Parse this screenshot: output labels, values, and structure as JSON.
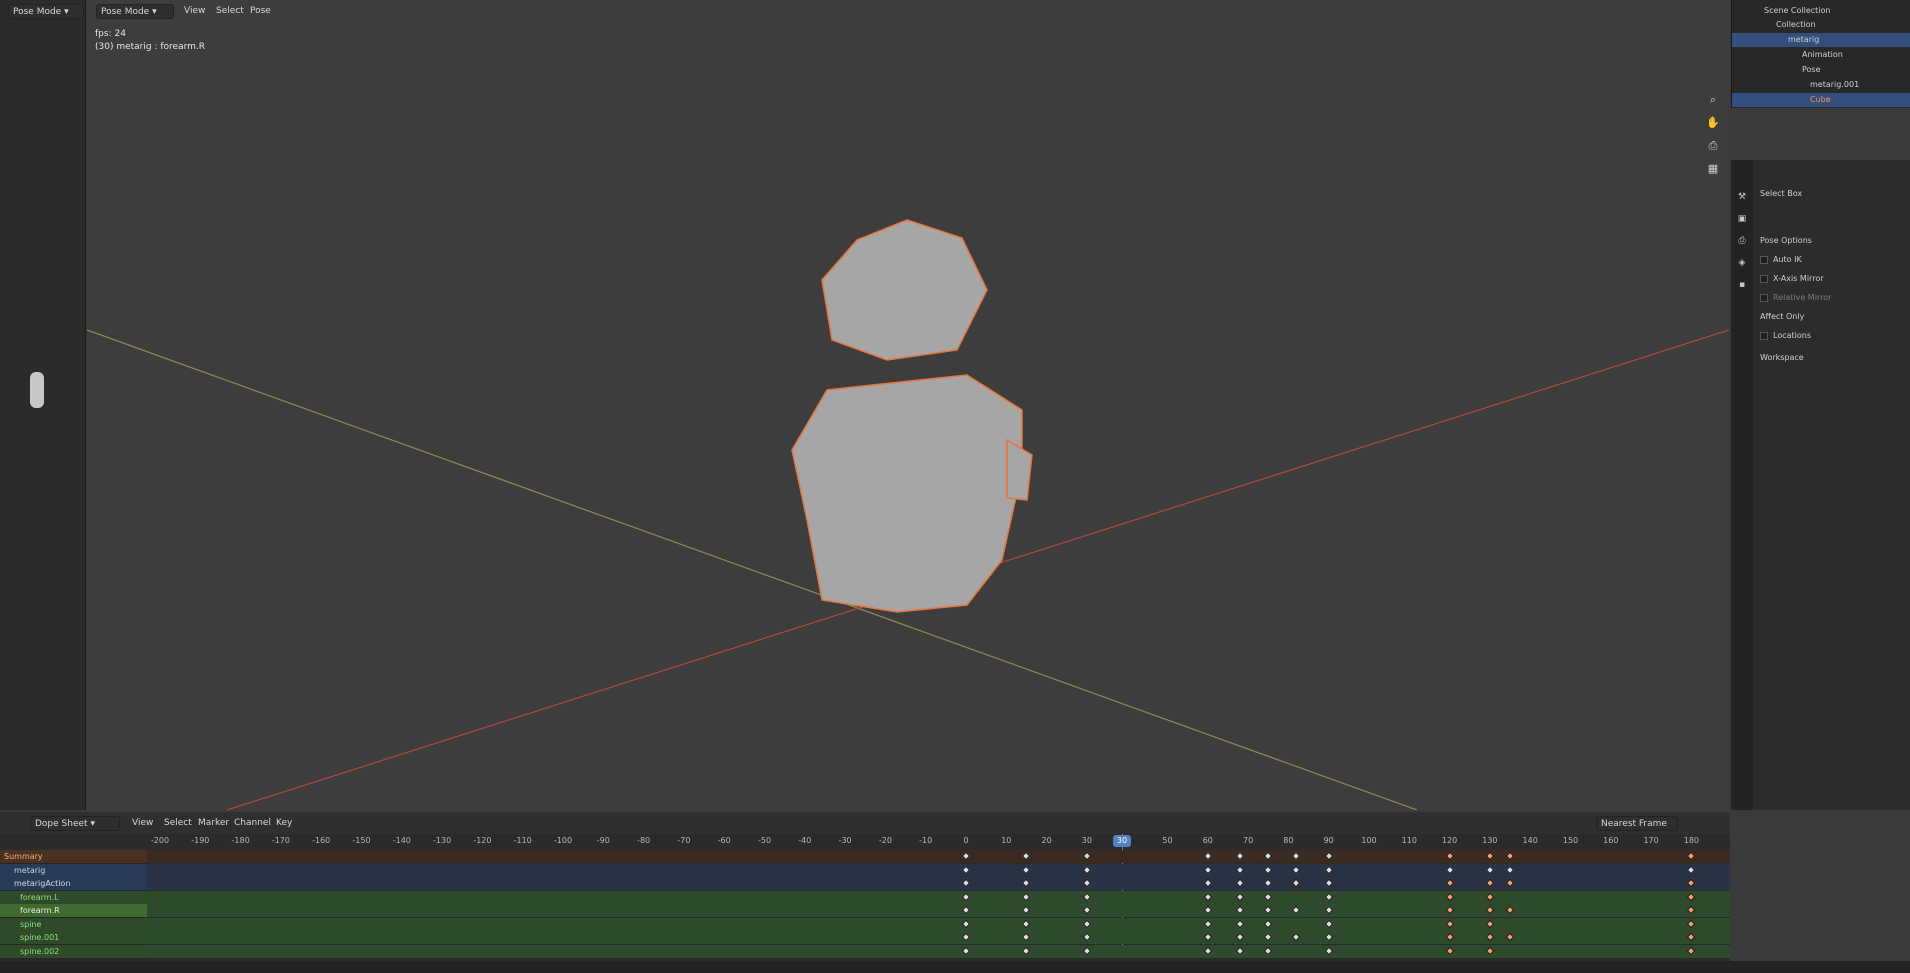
{
  "viewport": {
    "mode": "Pose Mode",
    "mode2": "Pose Mode",
    "menus": [
      "View",
      "Select",
      "Pose"
    ],
    "fps": "fps: 24",
    "active": "(30) metarig : forearm.R"
  },
  "outliner": {
    "root": "Scene Collection",
    "rows": [
      "Collection",
      "metarig",
      "Animation",
      "Pose",
      "metarig.001",
      "Cube"
    ]
  },
  "properties": {
    "tool": "Select Box",
    "section": "Pose Options",
    "options": [
      "Auto IK",
      "X-Axis Mirror",
      "Relative Mirror"
    ],
    "affect_label": "Affect Only",
    "affect_opt": "Locations",
    "workspace": "Workspace"
  },
  "dopesheet": {
    "editor": "Dope Sheet",
    "menus": [
      "View",
      "Select",
      "Marker",
      "Channel",
      "Key"
    ],
    "snap": "Nearest Frame",
    "current_frame": "30",
    "ticks": [
      "-200",
      "-190",
      "-180",
      "-170",
      "-160",
      "-150",
      "-140",
      "-130",
      "-120",
      "-110",
      "-100",
      "-90",
      "-80",
      "-70",
      "-60",
      "-50",
      "-40",
      "-30",
      "-20",
      "-10",
      "0",
      "10",
      "20",
      "30",
      "50",
      "60",
      "70",
      "80",
      "90",
      "100",
      "110",
      "120",
      "130",
      "140",
      "150",
      "160",
      "170",
      "180"
    ],
    "channels": [
      "Summary",
      "metarig",
      "metarigAction",
      "forearm.L",
      "forearm.R",
      "spine",
      "spine.001",
      "spine.002"
    ]
  },
  "colors": {
    "accent": "#5680c2",
    "selection": "#e8743b"
  }
}
